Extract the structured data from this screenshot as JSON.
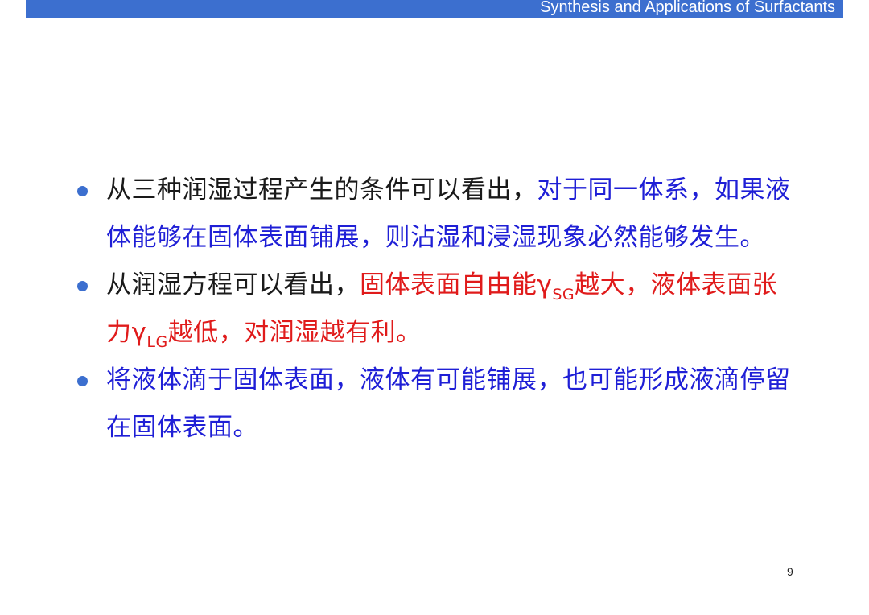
{
  "header": {
    "title": "Synthesis and Applications of Surfactants"
  },
  "bullets": [
    {
      "segments": [
        {
          "text": "从三种润湿过程产生的条件可以看出，",
          "color": "#1a1a1a"
        },
        {
          "text": "对于同一体系，如果液体能够在固体表面铺展，则沾湿和浸湿现象必然能够发生。",
          "color": "#1f1fd6"
        }
      ]
    },
    {
      "segments": [
        {
          "text": "从润湿方程可以看出，",
          "color": "#1a1a1a"
        },
        {
          "text": "固体表面自由能γ",
          "color": "#e01b1b"
        },
        {
          "text": "SG",
          "color": "#e01b1b",
          "subscript": true
        },
        {
          "text": "越大，液体表面张力γ",
          "color": "#e01b1b"
        },
        {
          "text": "LG",
          "color": "#e01b1b",
          "subscript": true
        },
        {
          "text": "越低，对润湿越有利。",
          "color": "#e01b1b"
        }
      ]
    },
    {
      "segments": [
        {
          "text": "将液体滴于固体表面，液体有可能铺展，也可能形成液滴停留在固体表面。",
          "color": "#1f1fd6"
        }
      ]
    }
  ],
  "page_number": "9",
  "colors": {
    "accent": "#3c6fcf",
    "black_text": "#1a1a1a",
    "blue_text": "#1f1fd6",
    "red_text": "#e01b1b"
  }
}
